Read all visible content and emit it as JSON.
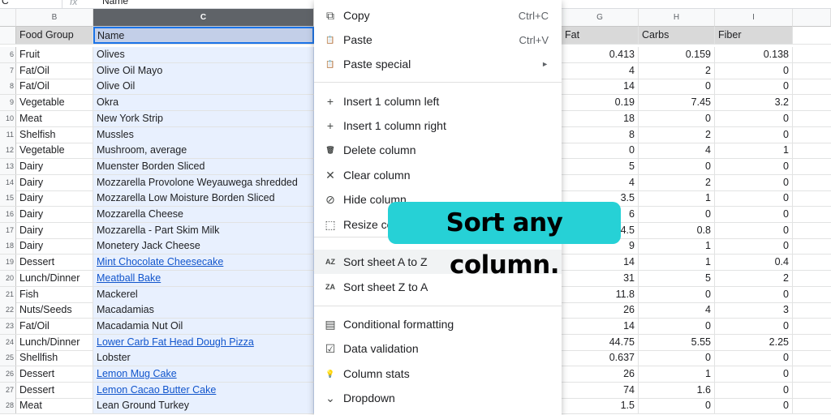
{
  "formula_bar": {
    "cell_ref": "C",
    "fx": "fx",
    "value": "Name"
  },
  "columns": {
    "B": "B",
    "C": "C",
    "G": "G",
    "H": "H",
    "I": "I"
  },
  "header_row": {
    "food_group": "Food Group",
    "name": "Name",
    "fat": "Fat",
    "carbs": "Carbs",
    "fiber": "Fiber"
  },
  "rows": [
    {
      "num": "6",
      "group": "Fruit",
      "name": "Olives",
      "fat": "0.413",
      "carbs": "0.159",
      "fiber": "0.138",
      "link": false
    },
    {
      "num": "7",
      "group": "Fat/Oil",
      "name": "Olive Oil Mayo",
      "fat": "4",
      "carbs": "2",
      "fiber": "0",
      "link": false
    },
    {
      "num": "8",
      "group": "Fat/Oil",
      "name": "Olive Oil",
      "fat": "14",
      "carbs": "0",
      "fiber": "0",
      "link": false
    },
    {
      "num": "9",
      "group": "Vegetable",
      "name": "Okra",
      "fat": "0.19",
      "carbs": "7.45",
      "fiber": "3.2",
      "link": false
    },
    {
      "num": "10",
      "group": "Meat",
      "name": "New York Strip",
      "fat": "18",
      "carbs": "0",
      "fiber": "0",
      "link": false
    },
    {
      "num": "11",
      "group": "Shelfish",
      "name": "Mussles",
      "fat": "8",
      "carbs": "2",
      "fiber": "0",
      "link": false
    },
    {
      "num": "12",
      "group": "Vegetable",
      "name": "Mushroom, average",
      "fat": "0",
      "carbs": "4",
      "fiber": "1",
      "link": false
    },
    {
      "num": "13",
      "group": "Dairy",
      "name": "Muenster Borden Sliced",
      "fat": "5",
      "carbs": "0",
      "fiber": "0",
      "link": false
    },
    {
      "num": "14",
      "group": "Dairy",
      "name": "Mozzarella Provolone Weyauwega shredded",
      "fat": "4",
      "carbs": "2",
      "fiber": "0",
      "link": false
    },
    {
      "num": "15",
      "group": "Dairy",
      "name": "Mozzarella Low Moisture Borden Sliced",
      "fat": "3.5",
      "carbs": "1",
      "fiber": "0",
      "link": false
    },
    {
      "num": "16",
      "group": "Dairy",
      "name": "Mozzarella Cheese",
      "fat": "6",
      "carbs": "0",
      "fiber": "0",
      "link": false
    },
    {
      "num": "17",
      "group": "Dairy",
      "name": "Mozzarella - Part Skim Milk",
      "fat": "4.5",
      "carbs": "0.8",
      "fiber": "0",
      "link": false
    },
    {
      "num": "18",
      "group": "Dairy",
      "name": "Monetery Jack Cheese",
      "fat": "9",
      "carbs": "1",
      "fiber": "0",
      "link": false
    },
    {
      "num": "19",
      "group": "Dessert",
      "name": "Mint Chocolate Cheesecake",
      "fat": "14",
      "carbs": "1",
      "fiber": "0.4",
      "link": true
    },
    {
      "num": "20",
      "group": "Lunch/Dinner",
      "name": "Meatball Bake",
      "fat": "31",
      "carbs": "5",
      "fiber": "2",
      "link": true
    },
    {
      "num": "21",
      "group": "Fish",
      "name": "Mackerel",
      "fat": "11.8",
      "carbs": "0",
      "fiber": "0",
      "link": false
    },
    {
      "num": "22",
      "group": "Nuts/Seeds",
      "name": "Macadamias",
      "fat": "26",
      "carbs": "4",
      "fiber": "3",
      "link": false
    },
    {
      "num": "23",
      "group": "Fat/Oil",
      "name": "Macadamia Nut Oil",
      "fat": "14",
      "carbs": "0",
      "fiber": "0",
      "link": false
    },
    {
      "num": "24",
      "group": "Lunch/Dinner",
      "name": "Lower Carb Fat Head Dough Pizza",
      "fat": "44.75",
      "carbs": "5.55",
      "fiber": "2.25",
      "link": true
    },
    {
      "num": "25",
      "group": "Shellfish",
      "name": "Lobster",
      "fat": "0.637",
      "carbs": "0",
      "fiber": "0",
      "link": false
    },
    {
      "num": "26",
      "group": "Dessert",
      "name": "Lemon Mug Cake",
      "fat": "26",
      "carbs": "1",
      "fiber": "0",
      "link": true
    },
    {
      "num": "27",
      "group": "Dessert",
      "name": "Lemon Cacao Butter Cake",
      "fat": "74",
      "carbs": "1.6",
      "fiber": "0",
      "link": true
    },
    {
      "num": "28",
      "group": "Meat",
      "name": "Lean Ground Turkey",
      "fat": "1.5",
      "carbs": "0",
      "fiber": "0",
      "link": false
    }
  ],
  "menu": {
    "items": [
      {
        "icon": "copy-icon",
        "glyph": "⧉",
        "label": "Copy",
        "shortcut": "Ctrl+C"
      },
      {
        "icon": "paste-icon",
        "glyph": "📋",
        "label": "Paste",
        "shortcut": "Ctrl+V"
      },
      {
        "icon": "paste-special-icon",
        "glyph": "📋",
        "label": "Paste special",
        "arrow": "►"
      },
      {
        "icon": "plus-icon",
        "glyph": "+",
        "label": "Insert 1 column left"
      },
      {
        "icon": "plus-icon",
        "glyph": "+",
        "label": "Insert 1 column right"
      },
      {
        "icon": "trash-icon",
        "glyph": "🗑",
        "label": "Delete column"
      },
      {
        "icon": "close-icon",
        "glyph": "✕",
        "label": "Clear column"
      },
      {
        "icon": "hide-icon",
        "glyph": "⊘",
        "label": "Hide column"
      },
      {
        "icon": "resize-icon",
        "glyph": "⬚",
        "label": "Resize co"
      },
      {
        "icon": "sort-az-icon",
        "glyph": "AZ",
        "label": "Sort sheet A to Z"
      },
      {
        "icon": "sort-za-icon",
        "glyph": "ZA",
        "label": "Sort sheet Z to A"
      },
      {
        "icon": "paint-roller-icon",
        "glyph": "▤",
        "label": "Conditional formatting"
      },
      {
        "icon": "data-validation-icon",
        "glyph": "☑",
        "label": "Data validation"
      },
      {
        "icon": "lightbulb-icon",
        "glyph": "💡",
        "label": "Column stats"
      },
      {
        "icon": "dropdown-icon",
        "glyph": "⌄",
        "label": "Dropdown"
      }
    ]
  },
  "callout": {
    "text": "Sort any column."
  },
  "colors": {
    "selection": "#e8f0fe",
    "accent": "#1a73e8",
    "callout": "#26d1d6",
    "link": "#1155cc"
  }
}
